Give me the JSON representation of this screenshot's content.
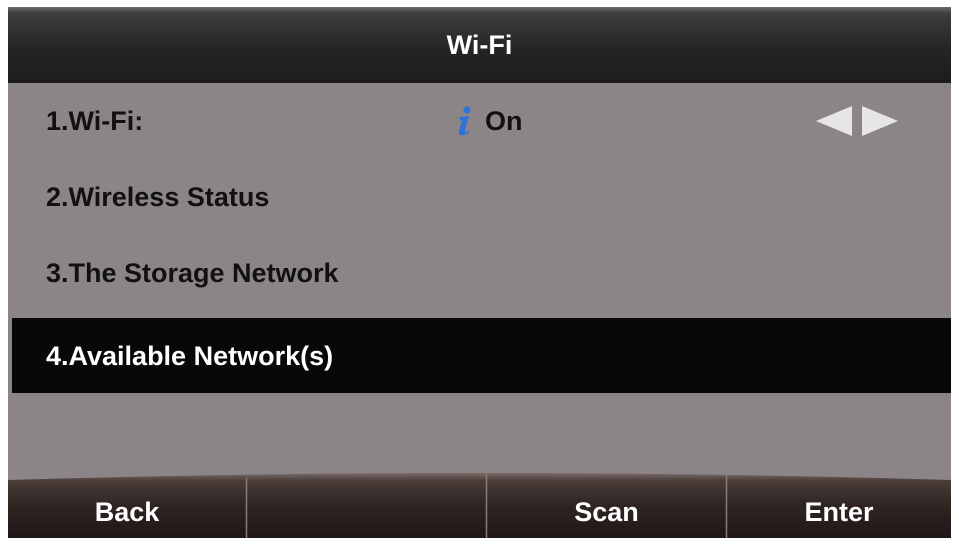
{
  "title": "Wi-Fi",
  "menu": {
    "items": [
      {
        "label": "1.Wi-Fi:",
        "value": "On",
        "info_icon": "info-icon",
        "switch_icon": "left-right-arrows-icon"
      },
      {
        "label": "2.Wireless Status"
      },
      {
        "label": "3.The Storage Network"
      },
      {
        "label": "4.Available Network(s)",
        "selected": true
      }
    ]
  },
  "softkeys": [
    "Back",
    "",
    "Scan",
    "Enter"
  ],
  "colors": {
    "background": "#8b8588",
    "title_bar": "#1c1c1c",
    "selected_row": "#080808",
    "text": "#111111",
    "info_icon": "#2f73d6",
    "arrows": "#e6e6e6"
  }
}
